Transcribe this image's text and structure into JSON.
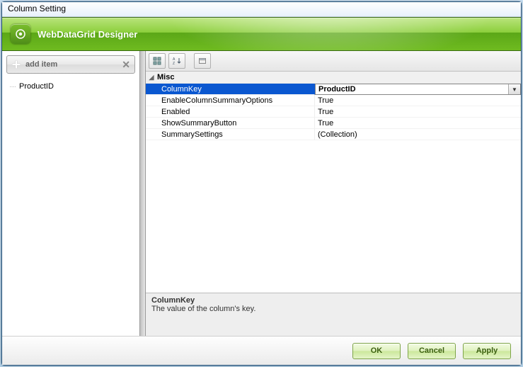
{
  "window": {
    "title": "Column Setting"
  },
  "header": {
    "title": "WebDataGrid Designer"
  },
  "sidebar": {
    "add_label": "add item",
    "items": [
      {
        "label": "ProductID"
      }
    ]
  },
  "toolbar": {
    "cat_label": "▦",
    "az_label": "A↓Z",
    "prop_label": "▭"
  },
  "props": {
    "category": "Misc",
    "rows": [
      {
        "name": "ColumnKey",
        "value": "ProductID",
        "selected": true,
        "dropdown": true
      },
      {
        "name": "EnableColumnSummaryOptions",
        "value": "True"
      },
      {
        "name": "Enabled",
        "value": "True"
      },
      {
        "name": "ShowSummaryButton",
        "value": "True"
      },
      {
        "name": "SummarySettings",
        "value": "(Collection)"
      }
    ],
    "desc_name": "ColumnKey",
    "desc_text": "The value of the column's key."
  },
  "footer": {
    "ok": "OK",
    "cancel": "Cancel",
    "apply": "Apply"
  }
}
